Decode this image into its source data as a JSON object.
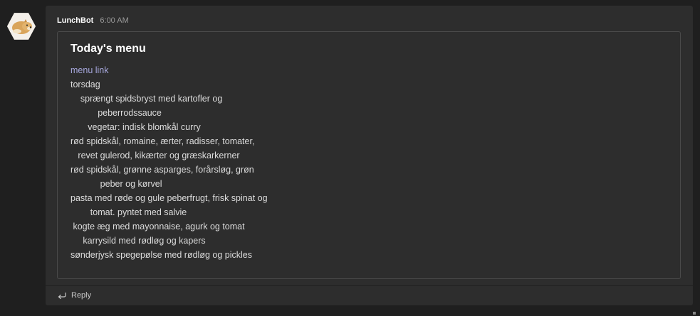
{
  "message": {
    "sender": "LunchBot",
    "time": "6:00 AM",
    "avatar_icon": "dog-avatar"
  },
  "card": {
    "title": "Today's menu",
    "link_label": "menu link",
    "lines": [
      "torsdag",
      "    sprængt spidsbryst med kartofler og",
      "           peberrodssauce",
      "       vegetar: indisk blomkål curry",
      "rød spidskål, romaine, ærter, radisser, tomater,",
      "   revet gulerod, kikærter og græskarkerner",
      "rød spidskål, grønne asparges, forårsløg, grøn",
      "            peber og kørvel",
      "pasta med røde og gule peberfrugt, frisk spinat og",
      "        tomat. pyntet med salvie",
      " kogte æg med mayonnaise, agurk og tomat",
      "     karrysild med rødløg og kapers",
      "sønderjysk spegepølse med rødløg og pickles"
    ]
  },
  "footer": {
    "reply_label": "Reply",
    "reply_icon": "reply-arrow-icon"
  },
  "colors": {
    "background": "#1f1f1f",
    "post": "#2d2d2d",
    "link": "#a6a7dc"
  }
}
